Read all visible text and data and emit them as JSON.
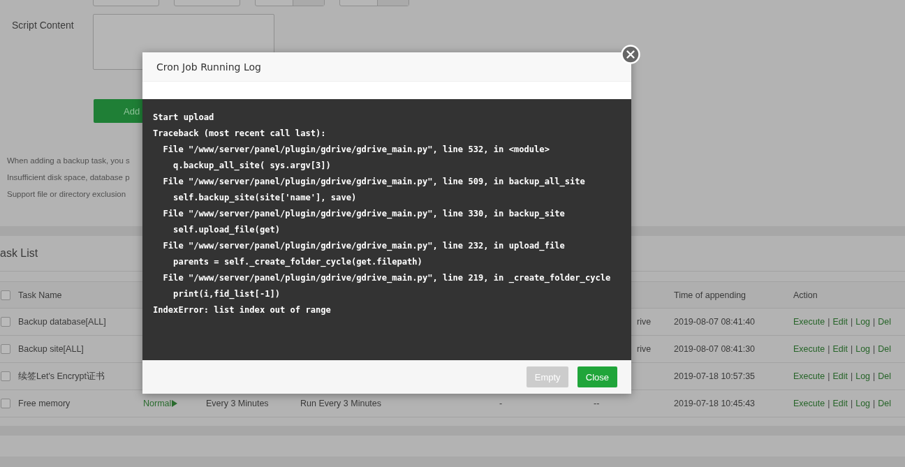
{
  "form": {
    "script_label": "Script Content",
    "add_button": "Add",
    "notes": [
      "When adding a backup task, you s",
      "Insufficient disk space, database p",
      "Support file or directory exclusion"
    ]
  },
  "task_list": {
    "title": "ask List",
    "header_checked": false,
    "columns": [
      {
        "label": "Task Name"
      },
      {},
      {},
      {},
      {},
      {},
      {
        "label": "Time of appending"
      },
      {
        "label": "Action"
      }
    ],
    "rows": [
      {
        "checked": false,
        "name": "Backup database[ALL]",
        "col6": "rive",
        "time": "2019-08-07 08:41:40",
        "actions": [
          "Execute",
          "Edit",
          "Log",
          "Del"
        ],
        "separators": [
          "|",
          "|",
          "|"
        ]
      },
      {
        "checked": false,
        "name": "Backup site[ALL]",
        "col6": "rive",
        "time": "2019-08-07 08:41:30",
        "actions": [
          "Execute",
          "Edit",
          "Log",
          "Del"
        ],
        "separators": [
          "|",
          "|",
          "|"
        ]
      },
      {
        "checked": false,
        "name": "续签Let's Encrypt证书",
        "time": "2019-07-18 10:57:35",
        "actions": [
          "Execute",
          "Edit",
          "Log",
          "Del"
        ],
        "separators": [
          "|",
          "|",
          "|"
        ]
      },
      {
        "checked": false,
        "name": "Free memory",
        "status": "Normal",
        "period": "Every 3 Minutes",
        "cycle": "Run Every 3 Minutes",
        "col5": "-",
        "col6": "--",
        "time": "2019-07-18 10:45:43",
        "actions": [
          "Execute",
          "Edit",
          "Log",
          "Del"
        ],
        "separators": [
          "|",
          "|",
          "|"
        ]
      }
    ]
  },
  "dialog": {
    "title": "Cron Job Running Log",
    "log": [
      "Start upload",
      "Traceback (most recent call last):",
      "  File \"/www/server/panel/plugin/gdrive/gdrive_main.py\", line 532, in <module>",
      "    q.backup_all_site( sys.argv[3])",
      "  File \"/www/server/panel/plugin/gdrive/gdrive_main.py\", line 509, in backup_all_site",
      "    self.backup_site(site['name'], save)",
      "  File \"/www/server/panel/plugin/gdrive/gdrive_main.py\", line 330, in backup_site",
      "    self.upload_file(get)",
      "  File \"/www/server/panel/plugin/gdrive/gdrive_main.py\", line 232, in upload_file",
      "    parents = self._create_folder_cycle(get.filepath)",
      "  File \"/www/server/panel/plugin/gdrive/gdrive_main.py\", line 219, in _create_folder_cycle",
      "    print(i,fid_list[-1])",
      "IndexError: list index out of range"
    ],
    "buttons": [
      {
        "label": "Empty",
        "disabled": true
      },
      {
        "label": "Close",
        "disabled": false
      }
    ]
  }
}
